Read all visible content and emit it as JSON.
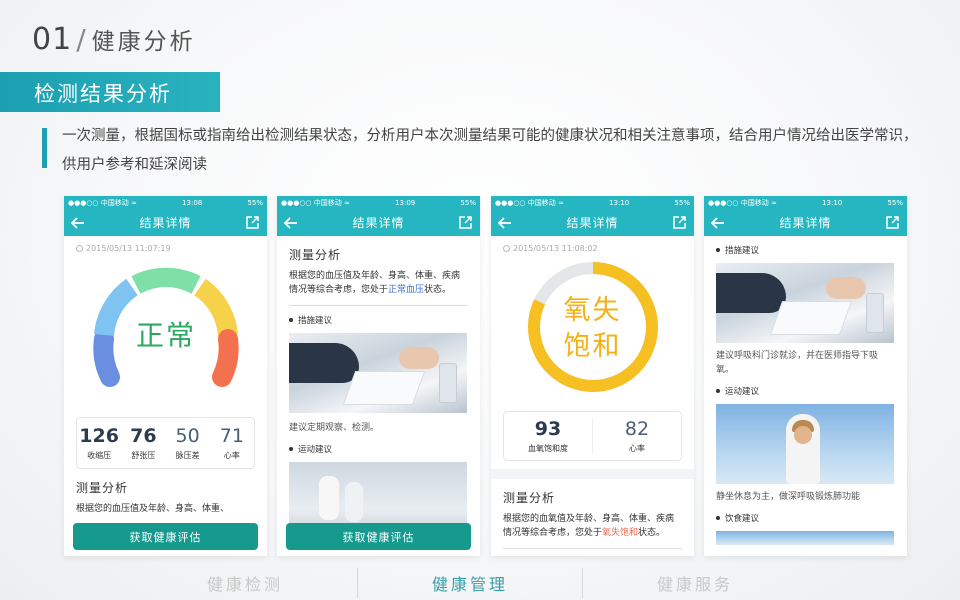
{
  "header": {
    "number": "01",
    "slash": "/",
    "title": "健康分析"
  },
  "banner": {
    "label": "检测结果分析"
  },
  "description": {
    "text": "一次测量，根据国标或指南给出检测结果状态，分析用户本次测量结果可能的健康状况和相关注意事项，结合用户情况给出医学常识，供用户参考和延深阅读"
  },
  "colors": {
    "accent": "#26b6c1",
    "button": "#169a8e",
    "normal_text": "#2aa860",
    "oxygen_text": "#f4b117",
    "highlight_blue": "#3a6fd0",
    "highlight_orange": "#f06b4f"
  },
  "phones": [
    {
      "status": {
        "carrier": "●●●○○ 中国移动 ≈",
        "time": "13:08",
        "battery": "55%"
      },
      "nav_title": "结果详情",
      "date": "2015/05/13 11:07:19",
      "gauge_label": "正常",
      "gauge_level": "normal",
      "stats": [
        {
          "value": "126",
          "label": "收缩压"
        },
        {
          "value": "76",
          "label": "舒张压"
        },
        {
          "value": "50",
          "label": "脉压差"
        },
        {
          "value": "71",
          "label": "心率"
        }
      ],
      "section_title": "测量分析",
      "para": "根据您的血压值及年龄、身高、体重、",
      "cta": "获取健康评估"
    },
    {
      "status": {
        "carrier": "●●●○○ 中国移动 ≈",
        "time": "13:09",
        "battery": "55%"
      },
      "nav_title": "结果详情",
      "section_title": "测量分析",
      "para_pre": "根据您的血压值及年龄、身高、体重、疾病情况等综合考虑，您处于",
      "para_hl": "正常血压",
      "para_post": "状态。",
      "bullet1": "措施建议",
      "advice": "建议定期观察、检测。",
      "bullet2": "运动建议",
      "cta": "获取健康评估"
    },
    {
      "status": {
        "carrier": "●●●○○ 中国移动 ≈",
        "time": "13:10",
        "battery": "55%"
      },
      "nav_title": "结果详情",
      "date": "2015/05/13 11:08:02",
      "ring_line1": "氧失",
      "ring_line2": "饱和",
      "ring_fraction": 0.82,
      "stats": [
        {
          "value": "93",
          "label": "血氧饱和度"
        },
        {
          "value": "82",
          "label": "心率"
        }
      ],
      "section_title": "测量分析",
      "para_pre": "根据您的血氧值及年龄、身高、体重、疾病情况等综合考虑，您处于",
      "para_hl": "氧失饱和",
      "para_post": "状态。"
    },
    {
      "status": {
        "carrier": "●●●○○ 中国移动 ≈",
        "time": "13:10",
        "battery": "55%"
      },
      "nav_title": "结果详情",
      "bullet1": "措施建议",
      "advice1": "建议呼吸科门诊就诊，并在医师指导下吸氧。",
      "bullet2": "运动建议",
      "advice2": "静坐休息为主，做深呼吸锻炼肺功能",
      "bullet3": "饮食建议"
    }
  ],
  "bottom_nav": [
    {
      "label": "健康检测",
      "active": false
    },
    {
      "label": "健康管理",
      "active": true
    },
    {
      "label": "健康服务",
      "active": false
    }
  ]
}
